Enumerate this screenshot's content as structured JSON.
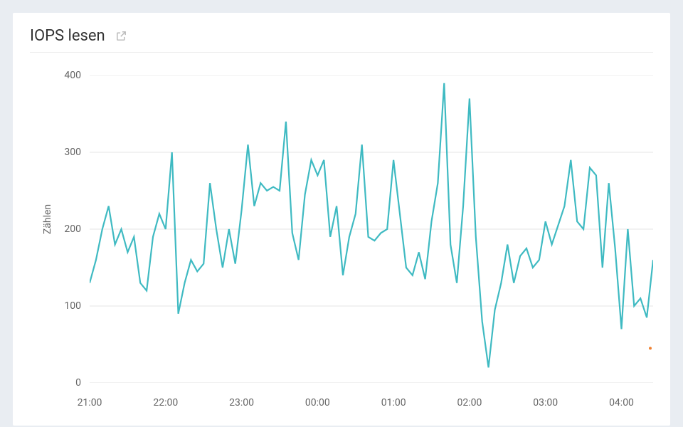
{
  "title": "IOPS lesen",
  "ylabel": "Zählen",
  "icons": {
    "external": "external-link-icon"
  },
  "colors": {
    "line": "#3fbac2",
    "grid": "#e5e5e5",
    "text": "#666666",
    "accent_dot": "#f08030"
  },
  "chart_data": {
    "type": "line",
    "xlabel": "",
    "ylabel": "Zählen",
    "title": "IOPS lesen",
    "ylim": [
      0,
      400
    ],
    "x_ticks": [
      "21:00",
      "22:00",
      "23:00",
      "00:00",
      "01:00",
      "02:00",
      "03:00",
      "04:00"
    ],
    "y_ticks": [
      0,
      100,
      200,
      300,
      400
    ],
    "x_range_minutes": [
      1260,
      1705
    ],
    "series": [
      {
        "name": "IOPS lesen",
        "color": "#3fbac2",
        "x_minutes": [
          1260,
          1265,
          1270,
          1275,
          1280,
          1285,
          1290,
          1295,
          1300,
          1305,
          1310,
          1315,
          1320,
          1325,
          1330,
          1335,
          1340,
          1345,
          1350,
          1355,
          1360,
          1365,
          1370,
          1375,
          1380,
          1385,
          1390,
          1395,
          1400,
          1405,
          1410,
          1415,
          1420,
          1425,
          1430,
          1435,
          1440,
          1445,
          1450,
          1455,
          1460,
          1465,
          1470,
          1475,
          1480,
          1485,
          1490,
          1495,
          1500,
          1505,
          1510,
          1515,
          1520,
          1525,
          1530,
          1535,
          1540,
          1545,
          1550,
          1555,
          1560,
          1565,
          1570,
          1575,
          1580,
          1585,
          1590,
          1595,
          1600,
          1605,
          1610,
          1615,
          1620,
          1625,
          1630,
          1635,
          1640,
          1645,
          1650,
          1655,
          1660,
          1665,
          1670,
          1675,
          1680,
          1685,
          1690,
          1695,
          1700,
          1705
        ],
        "values": [
          130,
          160,
          200,
          230,
          180,
          200,
          170,
          190,
          130,
          120,
          190,
          220,
          200,
          300,
          90,
          130,
          160,
          145,
          155,
          260,
          200,
          150,
          200,
          155,
          225,
          310,
          230,
          260,
          250,
          255,
          250,
          340,
          195,
          160,
          245,
          290,
          270,
          290,
          190,
          230,
          140,
          190,
          220,
          310,
          190,
          185,
          195,
          200,
          290,
          220,
          150,
          140,
          170,
          135,
          210,
          260,
          390,
          180,
          130,
          230,
          370,
          190,
          80,
          20,
          95,
          130,
          180,
          130,
          165,
          175,
          150,
          160,
          210,
          180,
          205,
          230,
          290,
          210,
          200,
          280,
          270,
          150,
          260,
          175,
          70,
          200,
          100,
          110,
          85,
          160
        ]
      }
    ]
  }
}
